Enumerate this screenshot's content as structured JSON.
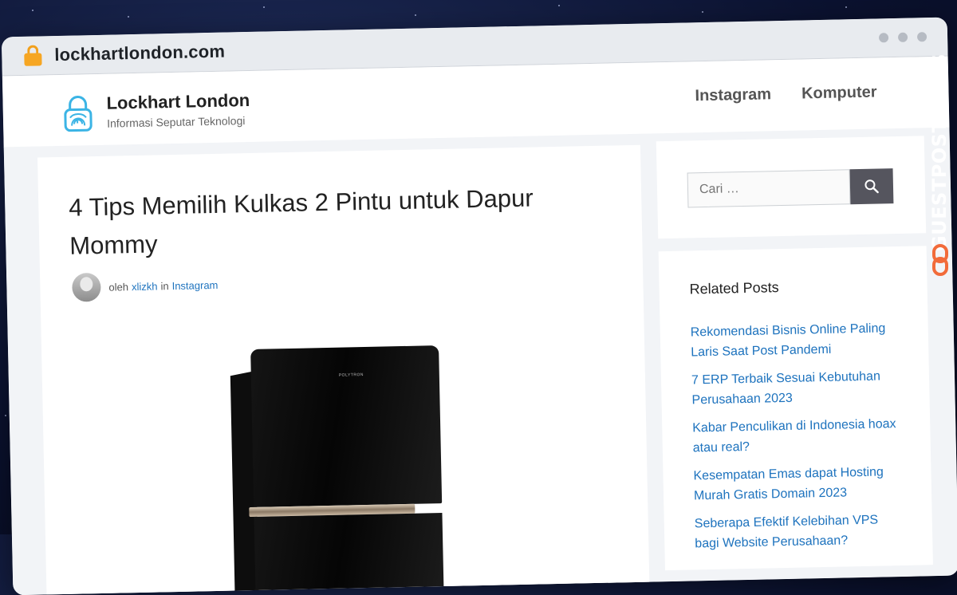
{
  "browser": {
    "url": "lockhartlondon.com"
  },
  "site": {
    "title": "Lockhart London",
    "tagline": "Informasi Seputar Teknologi",
    "nav": [
      {
        "label": "Instagram"
      },
      {
        "label": "Komputer"
      }
    ]
  },
  "article": {
    "title": "4 Tips Memilih Kulkas 2 Pintu untuk Dapur Mommy",
    "meta": {
      "by_label": "oleh",
      "author": "xlizkh",
      "in_label": "in",
      "category": "Instagram"
    },
    "image_brand": "POLYTRON"
  },
  "sidebar": {
    "search": {
      "placeholder": "Cari …"
    },
    "related": {
      "heading": "Related Posts",
      "posts": [
        {
          "title": "Rekomendasi Bisnis Online Paling Laris Saat Post Pandemi"
        },
        {
          "title": "7 ERP Terbaik Sesuai Kebutuhan Perusahaan 2023"
        },
        {
          "title": "Kabar Penculikan di Indonesia hoax atau real?"
        },
        {
          "title": "Kesempatan Emas dapat Hosting Murah Gratis Domain 2023"
        },
        {
          "title": "Seberapa Efektif Kelebihan VPS bagi Website Perusahaan?"
        }
      ]
    }
  },
  "watermark": {
    "text": "GUESTPOSTLINKS"
  },
  "colors": {
    "link": "#1e73be",
    "search_button": "#55555e",
    "lock": "#f6a623",
    "watermark_accent": "#f26b3a"
  },
  "icons": [
    "lock-icon",
    "fingerprint-lock-logo",
    "search-icon",
    "chain-link-icon"
  ]
}
